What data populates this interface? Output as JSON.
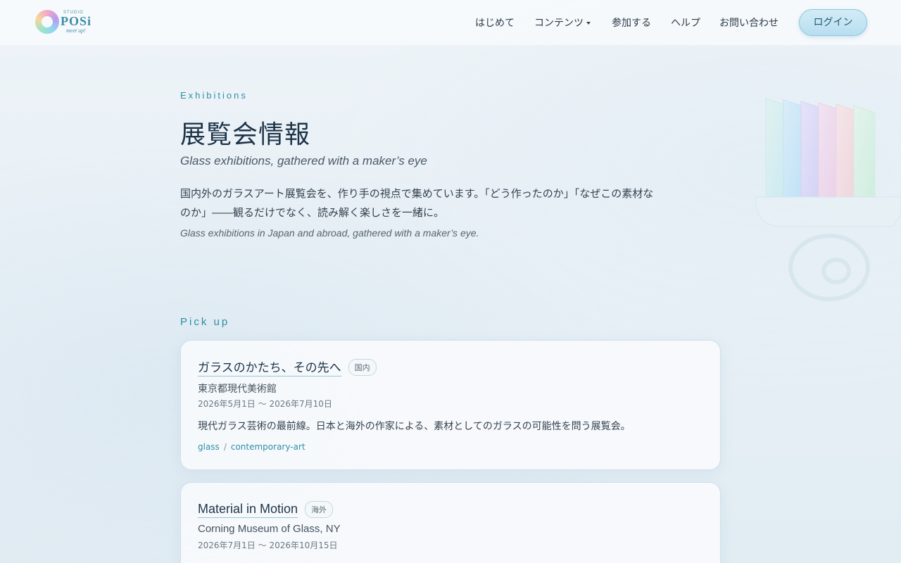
{
  "header": {
    "logo": {
      "studio": "STUDIO",
      "name": "POSi",
      "tagline": "meet up!"
    },
    "nav": [
      {
        "label": "はじめて"
      },
      {
        "label": "コンテンツ",
        "has_dropdown": true
      },
      {
        "label": "参加する"
      },
      {
        "label": "ヘルプ"
      },
      {
        "label": "お問い合わせ"
      }
    ],
    "login_label": "ログイン"
  },
  "hero": {
    "eyebrow": "Exhibitions",
    "title": "展覧会情報",
    "subtitle": "Glass exhibitions, gathered with a maker’s eye",
    "description": "国内外のガラスアート展覧会を、作り手の視点で集めています。「どう作ったのか」「なぜこの素材なのか」――観るだけでなく、読み解く楽しさを一緒に。",
    "description_en": "Glass exhibitions in Japan and abroad, gathered with a maker’s eye."
  },
  "pickup": {
    "heading": "Pick up",
    "cards": [
      {
        "title": "ガラスのかたち、その先へ",
        "badge": "国内",
        "venue": "東京都現代美術館",
        "date": "2026年5月1日 〜 2026年7月10日",
        "description": "現代ガラス芸術の最前線。日本と海外の作家による、素材としてのガラスの可能性を問う展覧会。",
        "tags": [
          "glass",
          "contemporary-art"
        ]
      },
      {
        "title": "Material in Motion",
        "badge": "海外",
        "venue": "Corning Museum of Glass, NY",
        "date": "2026年7月1日 〜 2026年10月15日"
      }
    ]
  },
  "colors": {
    "accent": "#2e8fa6",
    "title": "#1d3448",
    "login_bg": "#c5e5f3"
  }
}
